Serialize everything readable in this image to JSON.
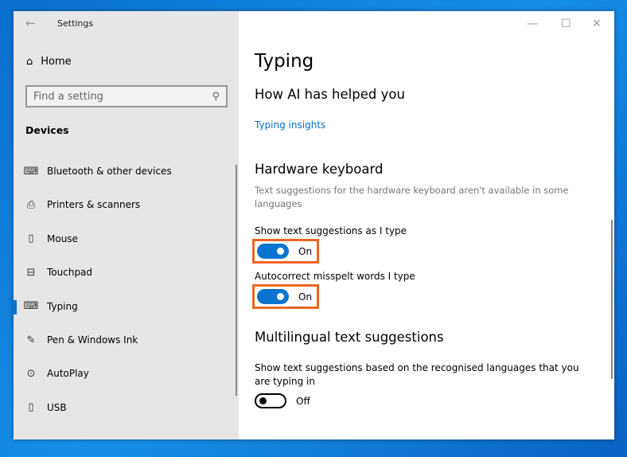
{
  "window": {
    "title": "Settings",
    "minimize": "—",
    "maximize": "☐",
    "close": "✕"
  },
  "sidebar": {
    "home": "Home",
    "search_placeholder": "Find a setting",
    "section": "Devices",
    "items": [
      {
        "label": "Bluetooth & other devices",
        "icon": "bluetooth-devices-icon",
        "glyph": "⌨"
      },
      {
        "label": "Printers & scanners",
        "icon": "printer-icon",
        "glyph": "⎙"
      },
      {
        "label": "Mouse",
        "icon": "mouse-icon",
        "glyph": "▯"
      },
      {
        "label": "Touchpad",
        "icon": "touchpad-icon",
        "glyph": "⊟"
      },
      {
        "label": "Typing",
        "icon": "keyboard-icon",
        "glyph": "⌨",
        "selected": true
      },
      {
        "label": "Pen & Windows Ink",
        "icon": "pen-icon",
        "glyph": "✎"
      },
      {
        "label": "AutoPlay",
        "icon": "autoplay-icon",
        "glyph": "⊙"
      },
      {
        "label": "USB",
        "icon": "usb-icon",
        "glyph": "▯"
      }
    ]
  },
  "main": {
    "title": "Typing",
    "ai_heading": "How AI has helped you",
    "insights_link": "Typing insights",
    "hw_heading": "Hardware keyboard",
    "hw_note": "Text suggestions for the hardware keyboard aren't available in some languages",
    "show_suggestions": {
      "label": "Show text suggestions as I type",
      "state": "On"
    },
    "autocorrect": {
      "label": "Autocorrect misspelt words I type",
      "state": "On"
    },
    "multi_heading": "Multilingual text suggestions",
    "multi": {
      "label": "Show text suggestions based on the recognised languages that you are typing in",
      "state": "Off"
    }
  },
  "colors": {
    "accent": "#0a74d1",
    "highlight": "#ee6522"
  }
}
